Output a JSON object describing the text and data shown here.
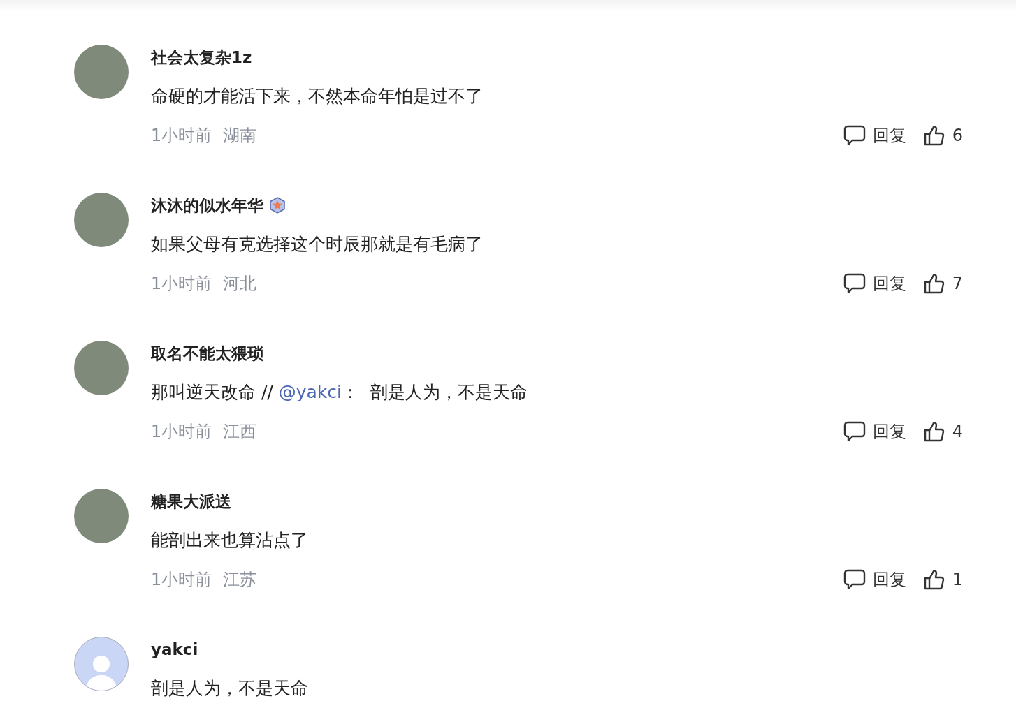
{
  "comments": [
    {
      "author": "社会太复杂1z",
      "kind": "photo",
      "badge": false,
      "parts": [
        {
          "kind": "text",
          "text": "命硬的才能活下来，不然本命年怕是过不了"
        }
      ],
      "time": "1小时前",
      "region": "湖南",
      "reply": "回复",
      "likes": "6"
    },
    {
      "author": "沐沐的似水年华",
      "kind": "photo",
      "badge": true,
      "parts": [
        {
          "kind": "text",
          "text": "如果父母有克选择这个时辰那就是有毛病了"
        }
      ],
      "time": "1小时前",
      "region": "河北",
      "reply": "回复",
      "likes": "7"
    },
    {
      "author": "取名不能太猥琐",
      "kind": "photo",
      "badge": false,
      "parts": [
        {
          "kind": "text",
          "text": "那叫逆天改命 // "
        },
        {
          "kind": "mention",
          "text": "@yakci"
        },
        {
          "kind": "text",
          "text": "：  剖是人为，不是天命"
        }
      ],
      "time": "1小时前",
      "region": "江西",
      "reply": "回复",
      "likes": "4"
    },
    {
      "author": "糖果大派送",
      "kind": "photo",
      "badge": false,
      "parts": [
        {
          "kind": "text",
          "text": "能剖出来也算沾点了"
        }
      ],
      "time": "1小时前",
      "region": "江苏",
      "reply": "回复",
      "likes": "1"
    },
    {
      "author": "yakci",
      "kind": "default",
      "badge": false,
      "parts": [
        {
          "kind": "text",
          "text": "剖是人为，不是天命"
        }
      ]
    }
  ]
}
